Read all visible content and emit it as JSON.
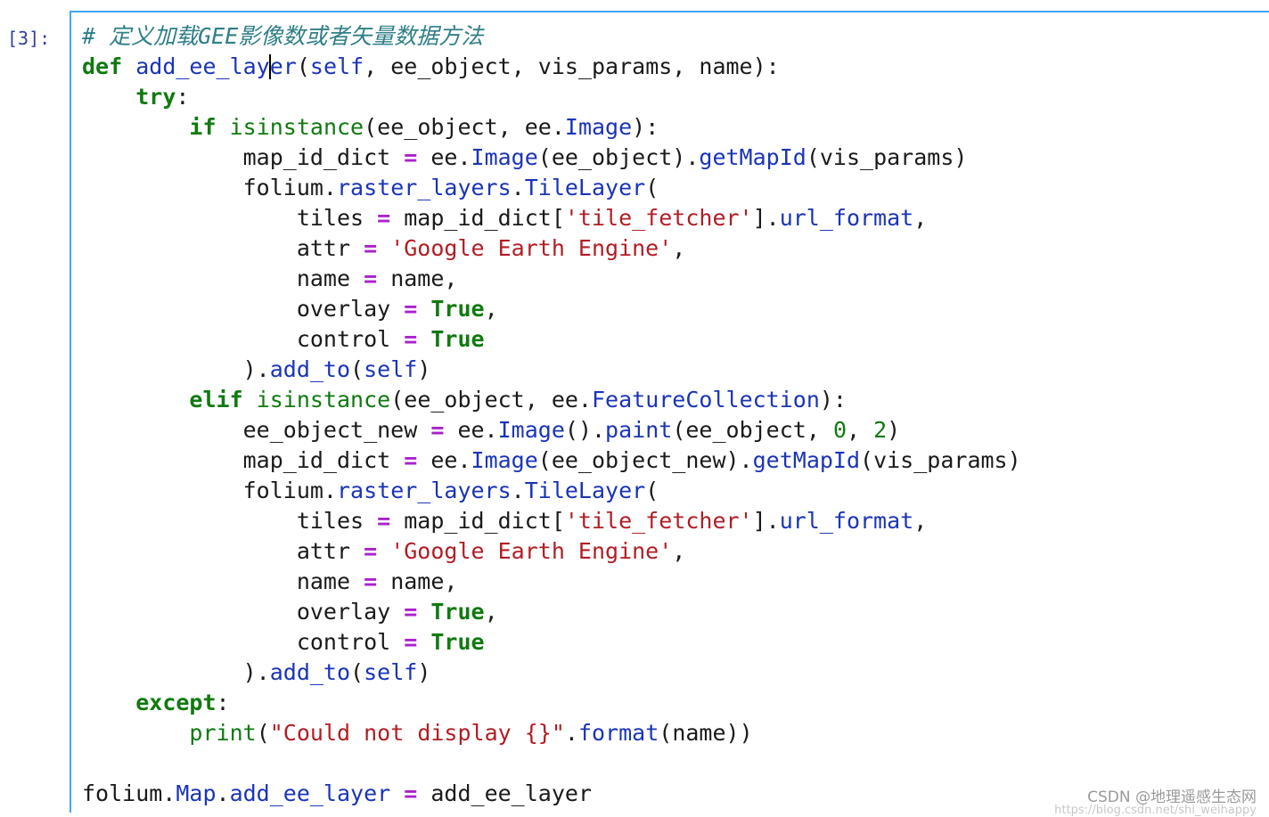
{
  "cell": {
    "prompt": "[3]:",
    "lines": [
      [
        {
          "t": "# 定义加载GEE影像数或者矢量数据方法",
          "c": "cmt"
        }
      ],
      [
        {
          "t": "def",
          "c": "kw"
        },
        {
          "t": " "
        },
        {
          "t": "add_ee_lay",
          "c": "fn"
        },
        {
          "cursor": true
        },
        {
          "t": "er",
          "c": "fn"
        },
        {
          "t": "("
        },
        {
          "t": "self",
          "c": "fn"
        },
        {
          "t": ", ee_object, vis_params, name):"
        }
      ],
      [
        {
          "t": "    "
        },
        {
          "t": "try",
          "c": "kw"
        },
        {
          "t": ":"
        }
      ],
      [
        {
          "t": "        "
        },
        {
          "t": "if",
          "c": "kw"
        },
        {
          "t": " "
        },
        {
          "t": "isinstance",
          "c": "bi"
        },
        {
          "t": "(ee_object, ee."
        },
        {
          "t": "Image",
          "c": "attr"
        },
        {
          "t": "):"
        }
      ],
      [
        {
          "t": "            map_id_dict "
        },
        {
          "t": "=",
          "c": "op"
        },
        {
          "t": " ee."
        },
        {
          "t": "Image",
          "c": "attr"
        },
        {
          "t": "(ee_object)."
        },
        {
          "t": "getMapId",
          "c": "attr"
        },
        {
          "t": "(vis_params)"
        }
      ],
      [
        {
          "t": "            folium."
        },
        {
          "t": "raster_layers",
          "c": "attr"
        },
        {
          "t": "."
        },
        {
          "t": "TileLayer",
          "c": "attr"
        },
        {
          "t": "("
        }
      ],
      [
        {
          "t": "                tiles "
        },
        {
          "t": "=",
          "c": "op"
        },
        {
          "t": " map_id_dict["
        },
        {
          "t": "'tile_fetcher'",
          "c": "str"
        },
        {
          "t": "]."
        },
        {
          "t": "url_format",
          "c": "attr"
        },
        {
          "t": ","
        }
      ],
      [
        {
          "t": "                attr "
        },
        {
          "t": "=",
          "c": "op"
        },
        {
          "t": " "
        },
        {
          "t": "'Google Earth Engine'",
          "c": "str"
        },
        {
          "t": ","
        }
      ],
      [
        {
          "t": "                name "
        },
        {
          "t": "=",
          "c": "op"
        },
        {
          "t": " name,"
        }
      ],
      [
        {
          "t": "                overlay "
        },
        {
          "t": "=",
          "c": "op"
        },
        {
          "t": " "
        },
        {
          "t": "True",
          "c": "kw"
        },
        {
          "t": ","
        }
      ],
      [
        {
          "t": "                control "
        },
        {
          "t": "=",
          "c": "op"
        },
        {
          "t": " "
        },
        {
          "t": "True",
          "c": "kw"
        }
      ],
      [
        {
          "t": "            )."
        },
        {
          "t": "add_to",
          "c": "attr"
        },
        {
          "t": "("
        },
        {
          "t": "self",
          "c": "fn"
        },
        {
          "t": ")"
        }
      ],
      [
        {
          "t": "        "
        },
        {
          "t": "elif",
          "c": "kw"
        },
        {
          "t": " "
        },
        {
          "t": "isinstance",
          "c": "bi"
        },
        {
          "t": "(ee_object, ee."
        },
        {
          "t": "FeatureCollection",
          "c": "attr"
        },
        {
          "t": "):"
        }
      ],
      [
        {
          "t": "            ee_object_new "
        },
        {
          "t": "=",
          "c": "op"
        },
        {
          "t": " ee."
        },
        {
          "t": "Image",
          "c": "attr"
        },
        {
          "t": "()."
        },
        {
          "t": "paint",
          "c": "attr"
        },
        {
          "t": "(ee_object, "
        },
        {
          "t": "0",
          "c": "num"
        },
        {
          "t": ", "
        },
        {
          "t": "2",
          "c": "num"
        },
        {
          "t": ")"
        }
      ],
      [
        {
          "t": "            map_id_dict "
        },
        {
          "t": "=",
          "c": "op"
        },
        {
          "t": " ee."
        },
        {
          "t": "Image",
          "c": "attr"
        },
        {
          "t": "(ee_object_new)."
        },
        {
          "t": "getMapId",
          "c": "attr"
        },
        {
          "t": "(vis_params)"
        }
      ],
      [
        {
          "t": "            folium."
        },
        {
          "t": "raster_layers",
          "c": "attr"
        },
        {
          "t": "."
        },
        {
          "t": "TileLayer",
          "c": "attr"
        },
        {
          "t": "("
        }
      ],
      [
        {
          "t": "                tiles "
        },
        {
          "t": "=",
          "c": "op"
        },
        {
          "t": " map_id_dict["
        },
        {
          "t": "'tile_fetcher'",
          "c": "str"
        },
        {
          "t": "]."
        },
        {
          "t": "url_format",
          "c": "attr"
        },
        {
          "t": ","
        }
      ],
      [
        {
          "t": "                attr "
        },
        {
          "t": "=",
          "c": "op"
        },
        {
          "t": " "
        },
        {
          "t": "'Google Earth Engine'",
          "c": "str"
        },
        {
          "t": ","
        }
      ],
      [
        {
          "t": "                name "
        },
        {
          "t": "=",
          "c": "op"
        },
        {
          "t": " name,"
        }
      ],
      [
        {
          "t": "                overlay "
        },
        {
          "t": "=",
          "c": "op"
        },
        {
          "t": " "
        },
        {
          "t": "True",
          "c": "kw"
        },
        {
          "t": ","
        }
      ],
      [
        {
          "t": "                control "
        },
        {
          "t": "=",
          "c": "op"
        },
        {
          "t": " "
        },
        {
          "t": "True",
          "c": "kw"
        }
      ],
      [
        {
          "t": "            )."
        },
        {
          "t": "add_to",
          "c": "attr"
        },
        {
          "t": "("
        },
        {
          "t": "self",
          "c": "fn"
        },
        {
          "t": ")"
        }
      ],
      [
        {
          "t": "    "
        },
        {
          "t": "except",
          "c": "kw"
        },
        {
          "t": ":"
        }
      ],
      [
        {
          "t": "        "
        },
        {
          "t": "print",
          "c": "bi"
        },
        {
          "t": "("
        },
        {
          "t": "\"Could not display {}\"",
          "c": "str"
        },
        {
          "t": "."
        },
        {
          "t": "format",
          "c": "attr"
        },
        {
          "t": "(name))"
        }
      ],
      [],
      [
        {
          "t": "folium."
        },
        {
          "t": "Map",
          "c": "attr"
        },
        {
          "t": "."
        },
        {
          "t": "add_ee_layer",
          "c": "attr"
        },
        {
          "t": " "
        },
        {
          "t": "=",
          "c": "op"
        },
        {
          "t": " add_ee_layer"
        }
      ]
    ]
  },
  "watermark": {
    "text": "CSDN @地理遥感生态网",
    "subtext": "https://blog.csdn.net/shi_weihappy"
  },
  "colors": {
    "prompt": "#303f9f",
    "editor_border": "#42a5f5",
    "keyword": "#107a10",
    "string": "#b21d24",
    "operator": "#aa22cc",
    "attribute": "#1a34b8",
    "comment": "#2f7f87"
  }
}
